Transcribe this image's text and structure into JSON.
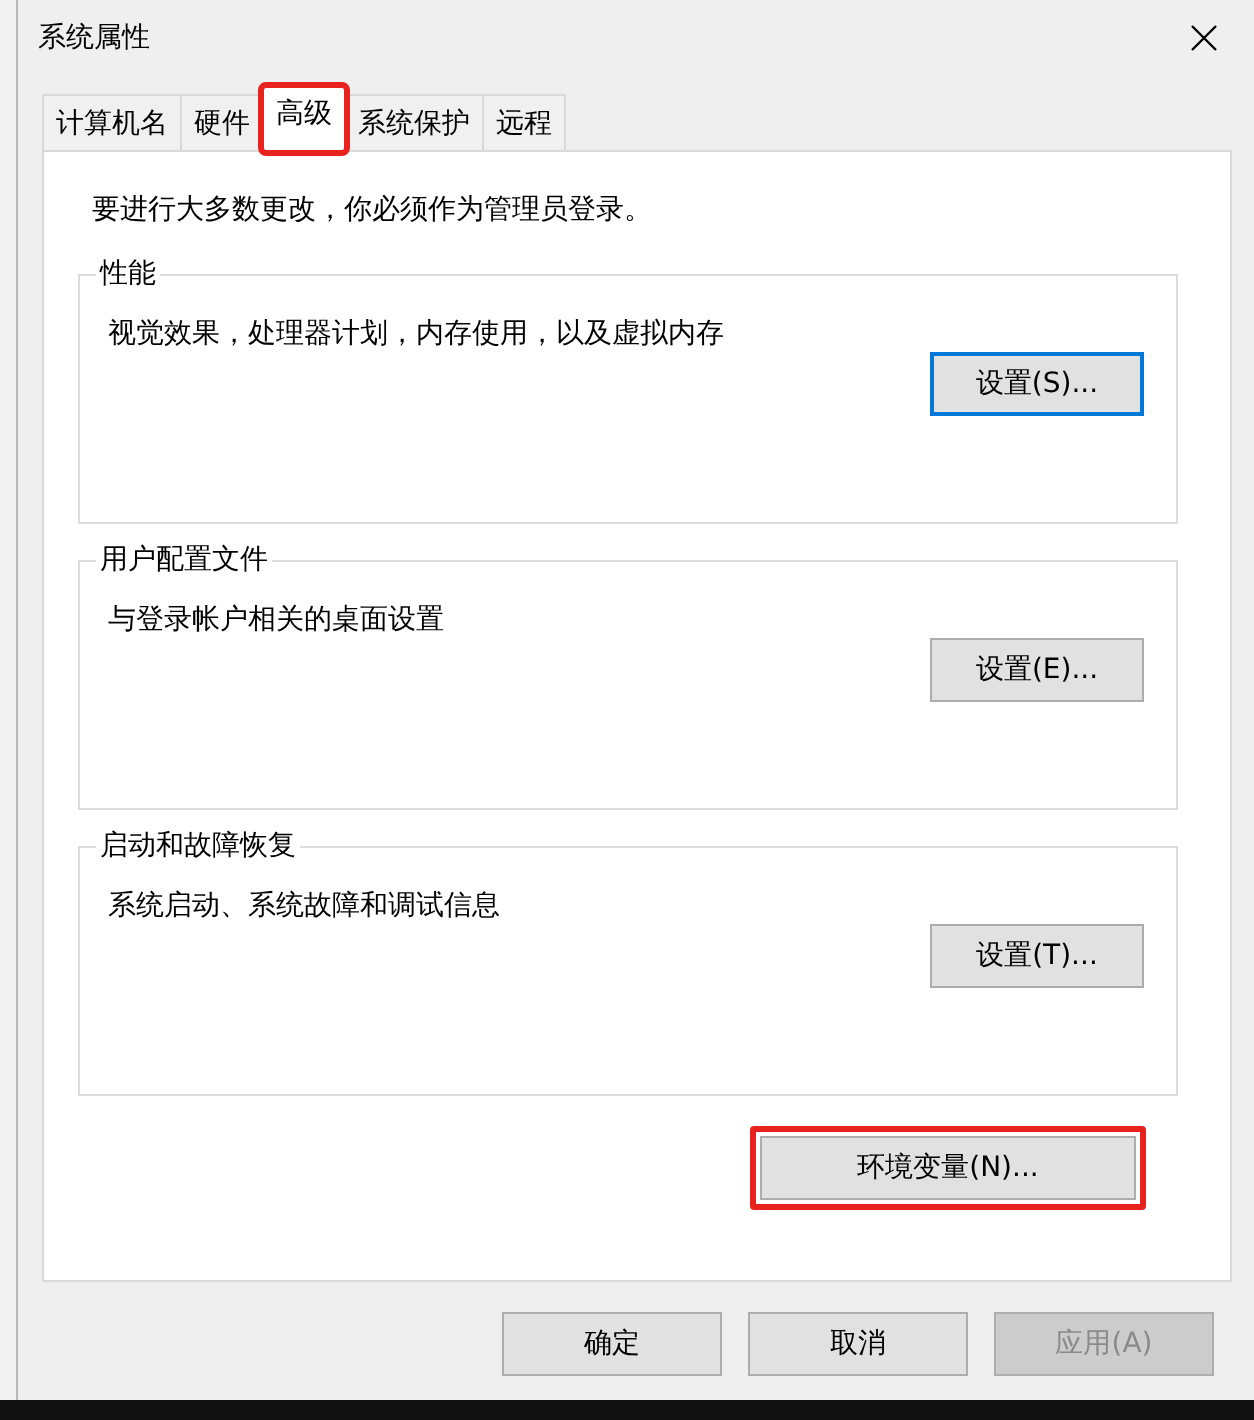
{
  "window": {
    "title": "系统属性"
  },
  "tabs": [
    {
      "label": "计算机名",
      "selected": false,
      "highlighted": false
    },
    {
      "label": "硬件",
      "selected": false,
      "highlighted": false
    },
    {
      "label": "高级",
      "selected": true,
      "highlighted": true
    },
    {
      "label": "系统保护",
      "selected": false,
      "highlighted": false
    },
    {
      "label": "远程",
      "selected": false,
      "highlighted": false
    }
  ],
  "notice": "要进行大多数更改，你必须作为管理员登录。",
  "groups": [
    {
      "title": "性能",
      "description": "视觉效果，处理器计划，内存使用，以及虚拟内存",
      "button": "设置(S)...",
      "focused": true
    },
    {
      "title": "用户配置文件",
      "description": "与登录帐户相关的桌面设置",
      "button": "设置(E)...",
      "focused": false
    },
    {
      "title": "启动和故障恢复",
      "description": "系统启动、系统故障和调试信息",
      "button": "设置(T)...",
      "focused": false
    }
  ],
  "env_button": {
    "label": "环境变量(N)...",
    "highlighted": true
  },
  "footer_buttons": [
    {
      "label": "确定",
      "disabled": false
    },
    {
      "label": "取消",
      "disabled": false
    },
    {
      "label": "应用(A)",
      "disabled": true
    }
  ]
}
